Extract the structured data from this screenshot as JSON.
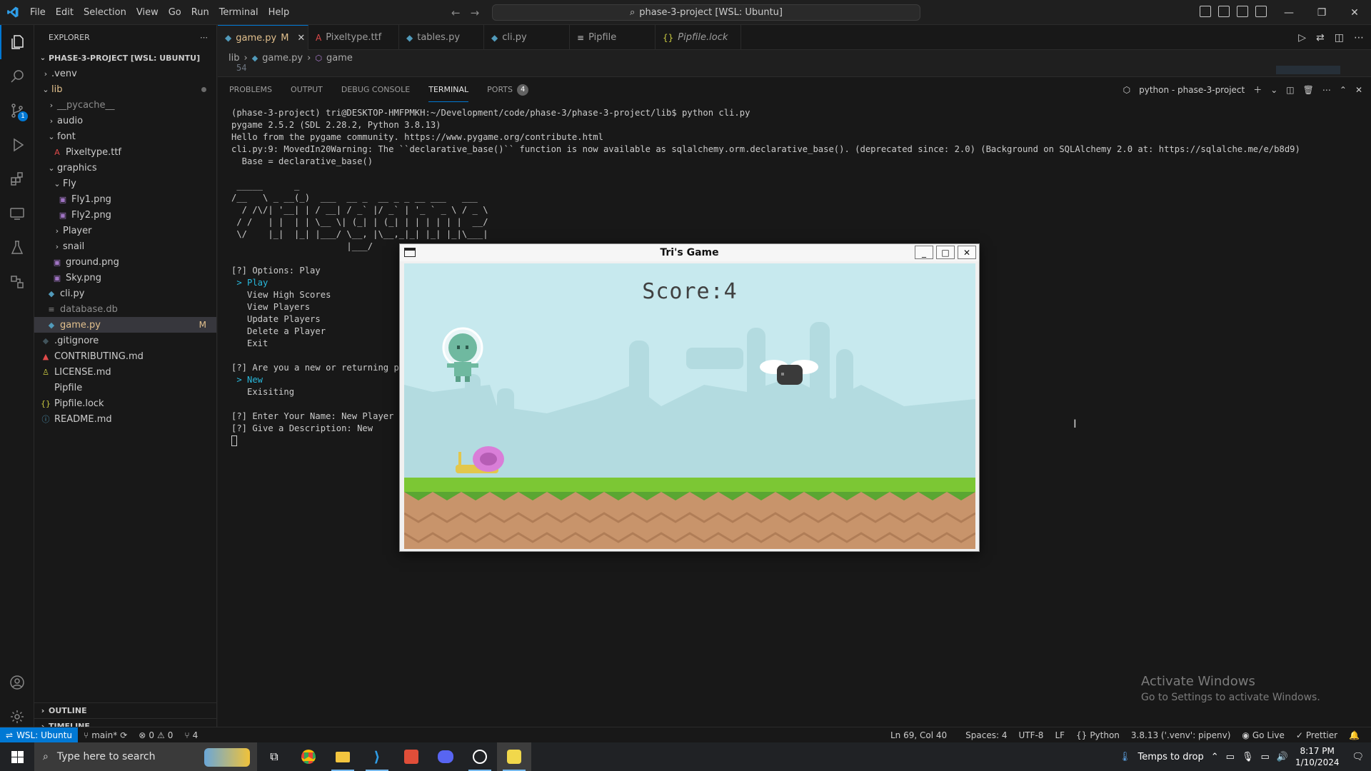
{
  "titlebar": {
    "menu": [
      "File",
      "Edit",
      "Selection",
      "View",
      "Go",
      "Run",
      "Terminal",
      "Help"
    ],
    "command_center": "phase-3-project [WSL: Ubuntu]"
  },
  "explorer": {
    "header": "EXPLORER",
    "root": "PHASE-3-PROJECT [WSL: UBUNTU]",
    "tree": [
      {
        "label": ".venv",
        "depth": 1,
        "type": "folder",
        "open": false,
        "style": ""
      },
      {
        "label": "lib",
        "depth": 1,
        "type": "folder",
        "open": true,
        "style": "mod",
        "dot": true
      },
      {
        "label": "__pycache__",
        "depth": 2,
        "type": "folder",
        "open": false,
        "style": "muted"
      },
      {
        "label": "audio",
        "depth": 2,
        "type": "folder",
        "open": false,
        "style": ""
      },
      {
        "label": "font",
        "depth": 2,
        "type": "folder",
        "open": true,
        "style": ""
      },
      {
        "label": "Pixeltype.ttf",
        "depth": 3,
        "type": "font",
        "style": ""
      },
      {
        "label": "graphics",
        "depth": 2,
        "type": "folder",
        "open": true,
        "style": ""
      },
      {
        "label": "Fly",
        "depth": 3,
        "type": "folder",
        "open": true,
        "style": ""
      },
      {
        "label": "Fly1.png",
        "depth": 4,
        "type": "image",
        "style": ""
      },
      {
        "label": "Fly2.png",
        "depth": 4,
        "type": "image",
        "style": ""
      },
      {
        "label": "Player",
        "depth": 3,
        "type": "folder",
        "open": false,
        "style": ""
      },
      {
        "label": "snail",
        "depth": 3,
        "type": "folder",
        "open": false,
        "style": ""
      },
      {
        "label": "ground.png",
        "depth": 3,
        "type": "image",
        "style": ""
      },
      {
        "label": "Sky.png",
        "depth": 3,
        "type": "image",
        "style": ""
      },
      {
        "label": "cli.py",
        "depth": 2,
        "type": "python",
        "style": ""
      },
      {
        "label": "database.db",
        "depth": 2,
        "type": "db",
        "style": "muted"
      },
      {
        "label": "game.py",
        "depth": 2,
        "type": "python",
        "style": "mod",
        "selected": true,
        "flag": "M"
      },
      {
        "label": ".gitignore",
        "depth": 1,
        "type": "git",
        "style": ""
      },
      {
        "label": "CONTRIBUTING.md",
        "depth": 1,
        "type": "md",
        "style": ""
      },
      {
        "label": "LICENSE.md",
        "depth": 1,
        "type": "license",
        "style": ""
      },
      {
        "label": "Pipfile",
        "depth": 1,
        "type": "pipfile",
        "style": ""
      },
      {
        "label": "Pipfile.lock",
        "depth": 1,
        "type": "json",
        "style": ""
      },
      {
        "label": "README.md",
        "depth": 1,
        "type": "info",
        "style": ""
      }
    ],
    "outline": "OUTLINE",
    "timeline": "TIMELINE"
  },
  "tabs": [
    {
      "label": "game.py",
      "suffix": "M",
      "icon": "python-icon",
      "active": true
    },
    {
      "label": "Pixeltype.ttf",
      "icon": "font-icon"
    },
    {
      "label": "tables.py",
      "icon": "python-icon"
    },
    {
      "label": "cli.py",
      "icon": "python-icon"
    },
    {
      "label": "Pipfile",
      "icon": "pipfile-icon"
    },
    {
      "label": "Pipfile.lock",
      "icon": "json-icon",
      "italic": true
    }
  ],
  "breadcrumb": {
    "part1": "lib",
    "part2": "game.py",
    "part3": "game"
  },
  "editor": {
    "line_number": "54"
  },
  "panel": {
    "tabs": [
      "PROBLEMS",
      "OUTPUT",
      "DEBUG CONSOLE",
      "TERMINAL",
      "PORTS"
    ],
    "ports_count": "4",
    "terminal_name": "python - phase-3-project"
  },
  "terminal_lines": [
    "(phase-3-project) tri@DESKTOP-HMFPMKH:~/Development/code/phase-3/phase-3-project/lib$ python cli.py",
    "pygame 2.5.2 (SDL 2.28.2, Python 3.8.13)",
    "Hello from the pygame community. https://www.pygame.org/contribute.html",
    "cli.py:9: MovedIn20Warning: The ``declarative_base()`` function is now available as sqlalchemy.orm.declarative_base(). (deprecated since: 2.0) (Background on SQLAlchemy 2.0 at: https://sqlalche.me/e/b8d9)",
    "  Base = declarative_base()",
    "",
    " _____      _",
    "/__   \\ _ __(_)  ___  __ _  __ _ _ __ ___   ___",
    "  / /\\/| '__| | / __| / _` |/ _` | '_ ` _ \\ / _ \\",
    " / /   | |  | | \\__ \\| (_| | (_| | | | | | |  __/",
    " \\/    |_|  |_| |___/ \\__, |\\__,_|_| |_| |_|\\___|",
    "                      |___/",
    "",
    "[?] Options: Play",
    " > Play",
    "   View High Scores",
    "   View Players",
    "   Update Players",
    "   Delete a Player",
    "   Exit",
    "",
    "[?] Are you a new or returning pla",
    " > New",
    "   Exisiting",
    "",
    "[?] Enter Your Name: New Player",
    "[?] Give a Description: New",
    ""
  ],
  "activate_windows": {
    "line1": "Activate Windows",
    "line2": "Go to Settings to activate Windows."
  },
  "game_window": {
    "title": "Tri's Game",
    "score_label": "Score:4"
  },
  "statusbar": {
    "remote": "WSL: Ubuntu",
    "branch": "main*",
    "errors": "0",
    "warnings": "0",
    "ports": "4",
    "position": "Ln 69, Col 40",
    "spaces": "Spaces: 4",
    "encoding": "UTF-8",
    "eol": "LF",
    "language": "Python",
    "interpreter": "3.8.13 ('.venv': pipenv)",
    "golive": "Go Live",
    "prettier": "Prettier"
  },
  "taskbar": {
    "search_placeholder": "Type here to search",
    "weather": "Temps to drop",
    "time": "8:17 PM",
    "date": "1/10/2024"
  },
  "colors": {
    "accent": "#0078d4",
    "sky": "#c7e9ee",
    "grass": "#7cc734",
    "dirt": "#c8946b"
  }
}
